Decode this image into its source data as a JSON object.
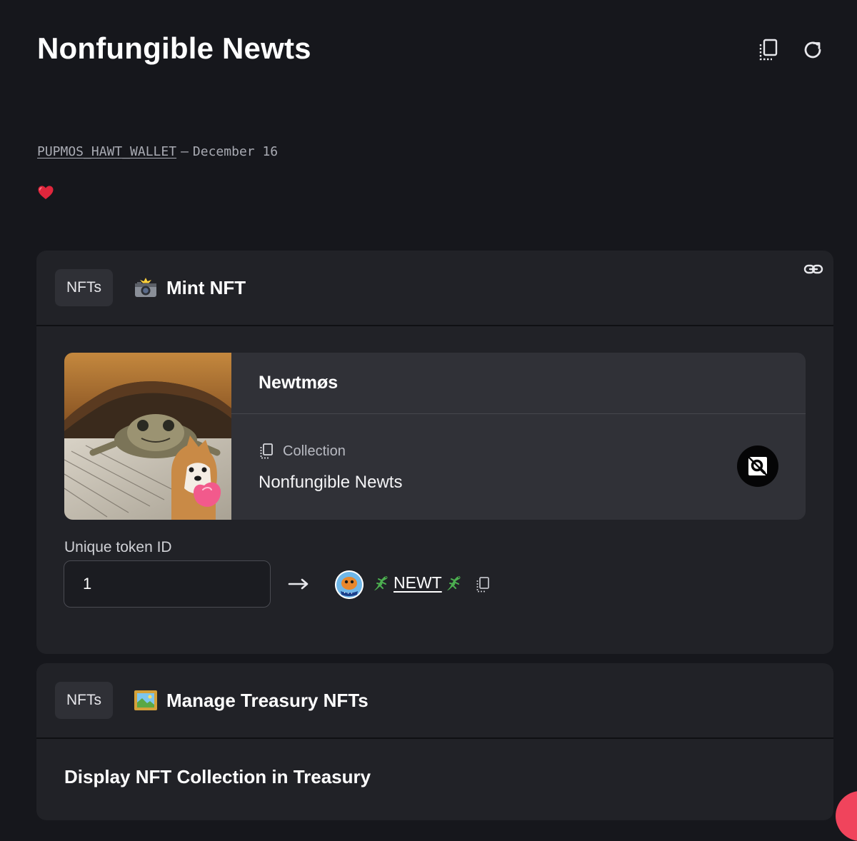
{
  "header": {
    "title": "Nonfungible Newts",
    "icons": [
      "copy-icon",
      "refresh-icon"
    ]
  },
  "meta": {
    "author": "PUPMOS_HAWT_WALLET",
    "separator": "–",
    "date": "December 16",
    "reaction_icon": "heart-icon"
  },
  "cards": [
    {
      "tag": "NFTs",
      "title_icon": "camera-flash-icon",
      "title": "Mint NFT",
      "link_icon": "link-icon",
      "nft": {
        "name": "Newtmøs",
        "collection_label": "Collection",
        "collection_value": "Nonfungible Newts",
        "badge_icon": "stargaze-icon"
      },
      "token": {
        "label": "Unique token ID",
        "value": "1"
      },
      "recipient": {
        "name": "NEWT",
        "icons": [
          "lizard-icon",
          "lizard-icon",
          "copy-icon"
        ]
      }
    },
    {
      "tag": "NFTs",
      "title_icon": "framed-picture-icon",
      "title": "Manage Treasury NFTs",
      "section_title": "Display NFT Collection in Treasury"
    }
  ],
  "colors": {
    "background": "#16171c",
    "card": "#212227",
    "panel": "#303137",
    "accent_red": "#f0445c"
  }
}
